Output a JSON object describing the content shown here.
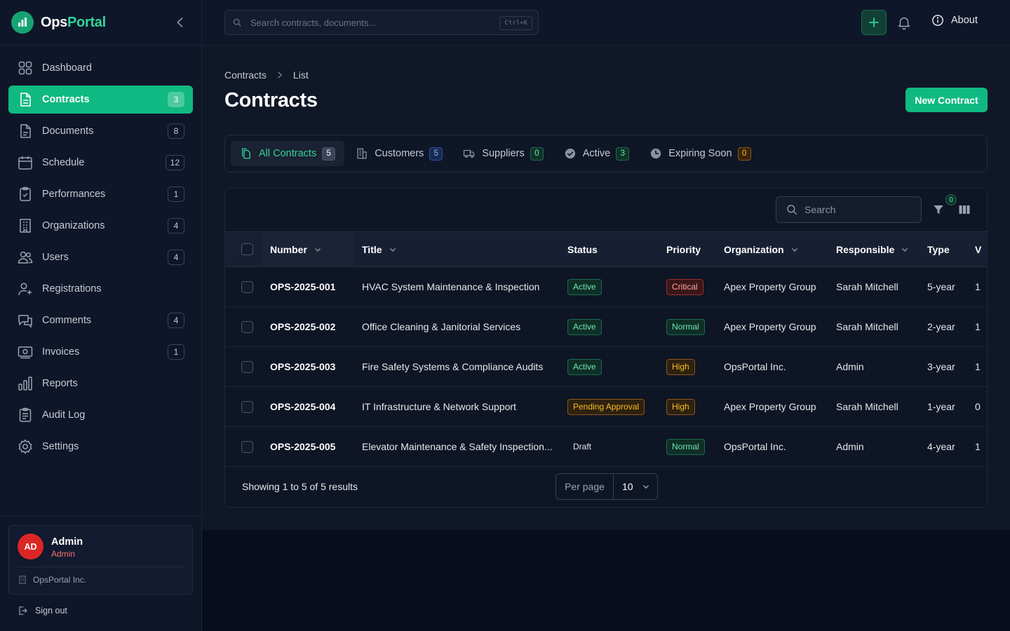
{
  "brand": {
    "name_main": "Ops",
    "name_accent": "Portal"
  },
  "sidebar": {
    "items": [
      {
        "label": "Dashboard",
        "count": "",
        "icon": "dashboard-icon"
      },
      {
        "label": "Contracts",
        "count": "3",
        "icon": "file-text-icon",
        "active": true
      },
      {
        "label": "Documents",
        "count": "8",
        "icon": "document-icon"
      },
      {
        "label": "Schedule",
        "count": "12",
        "icon": "calendar-icon"
      },
      {
        "label": "Performances",
        "count": "1",
        "icon": "clipboard-check-icon"
      },
      {
        "label": "Organizations",
        "count": "4",
        "icon": "building-icon"
      },
      {
        "label": "Users",
        "count": "4",
        "icon": "users-icon"
      },
      {
        "label": "Registrations",
        "count": "",
        "icon": "user-plus-icon"
      },
      {
        "label": "Comments",
        "count": "4",
        "icon": "comments-icon"
      },
      {
        "label": "Invoices",
        "count": "1",
        "icon": "invoice-icon"
      },
      {
        "label": "Reports",
        "count": "",
        "icon": "bar-chart-icon"
      },
      {
        "label": "Audit Log",
        "count": "",
        "icon": "audit-log-icon"
      },
      {
        "label": "Settings",
        "count": "",
        "icon": "gear-icon"
      }
    ],
    "user": {
      "initials": "AD",
      "name": "Admin",
      "role": "Admin",
      "org": "OpsPortal Inc."
    },
    "signout_label": "Sign out"
  },
  "topbar": {
    "search_placeholder": "Search contracts, documents...",
    "search_shortcut": "Ctrl+K",
    "about_label": "About"
  },
  "page": {
    "breadcrumb": [
      "Contracts",
      "List"
    ],
    "title": "Contracts",
    "new_button_label": "New Contract"
  },
  "tabs": [
    {
      "label": "All Contracts",
      "count": "5",
      "icon": "files-icon",
      "active": true
    },
    {
      "label": "Customers",
      "count": "5",
      "icon": "office-building-icon"
    },
    {
      "label": "Suppliers",
      "count": "0",
      "icon": "truck-icon"
    },
    {
      "label": "Active",
      "count": "3",
      "icon": "check-circle-icon"
    },
    {
      "label": "Expiring Soon",
      "count": "0",
      "icon": "clock-icon"
    }
  ],
  "table": {
    "search_placeholder": "Search",
    "filter_count": "0",
    "columns": [
      "Number",
      "Title",
      "Status",
      "Priority",
      "Organization",
      "Responsible",
      "Type",
      "V"
    ],
    "rows": [
      {
        "number": "OPS-2025-001",
        "title": "HVAC System Maintenance & Inspection",
        "status": "Active",
        "priority": "Critical",
        "organization": "Apex Property Group",
        "responsible": "Sarah Mitchell",
        "type": "5-year",
        "v": "1"
      },
      {
        "number": "OPS-2025-002",
        "title": "Office Cleaning & Janitorial Services",
        "status": "Active",
        "priority": "Normal",
        "organization": "Apex Property Group",
        "responsible": "Sarah Mitchell",
        "type": "2-year",
        "v": "1"
      },
      {
        "number": "OPS-2025-003",
        "title": "Fire Safety Systems & Compliance Audits",
        "status": "Active",
        "priority": "High",
        "organization": "OpsPortal Inc.",
        "responsible": "Admin",
        "type": "3-year",
        "v": "1"
      },
      {
        "number": "OPS-2025-004",
        "title": "IT Infrastructure & Network Support",
        "status": "Pending Approval",
        "priority": "High",
        "organization": "Apex Property Group",
        "responsible": "Sarah Mitchell",
        "type": "1-year",
        "v": "0"
      },
      {
        "number": "OPS-2025-005",
        "title": "Elevator Maintenance & Safety Inspection...",
        "status": "Draft",
        "priority": "Normal",
        "organization": "OpsPortal Inc.",
        "responsible": "Admin",
        "type": "4-year",
        "v": "1"
      }
    ],
    "showing_text": "Showing 1 to 5 of 5 results",
    "per_page_label": "Per page",
    "per_page_value": "10"
  },
  "colors": {
    "accent": "#10b981",
    "background": "#070d1d",
    "sidebar": "#0f1629",
    "danger": "#dc2626"
  }
}
